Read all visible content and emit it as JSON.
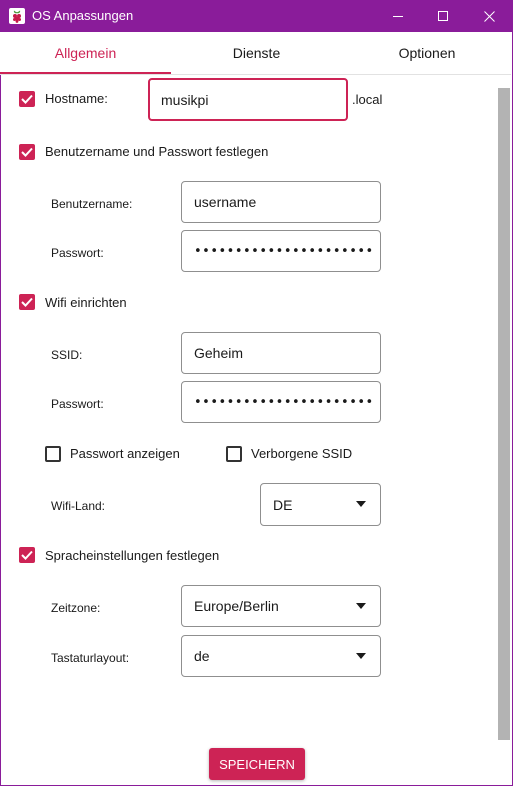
{
  "window": {
    "title": "OS Anpassungen"
  },
  "colors": {
    "titlebar": "#8a1c9a",
    "accent": "#cd2355"
  },
  "tabs": [
    {
      "label": "Allgemein",
      "active": true
    },
    {
      "label": "Dienste",
      "active": false
    },
    {
      "label": "Optionen",
      "active": false
    }
  ],
  "hostname": {
    "checked": true,
    "label": "Hostname:",
    "value": "musikpi",
    "suffix": ".local"
  },
  "user": {
    "checked": true,
    "label": "Benutzername und Passwort festlegen",
    "username_label": "Benutzername:",
    "username_value": "username",
    "password_label": "Passwort:",
    "password_value": "••••••••••••••••••••••"
  },
  "wifi": {
    "checked": true,
    "label": "Wifi einrichten",
    "ssid_label": "SSID:",
    "ssid_value": "Geheim",
    "password_label": "Passwort:",
    "password_value": "••••••••••••••••••••••",
    "show_password_label": "Passwort anzeigen",
    "show_password_checked": false,
    "hidden_ssid_label": "Verborgene SSID",
    "hidden_ssid_checked": false,
    "country_label": "Wifi-Land:",
    "country_value": "DE"
  },
  "locale": {
    "checked": true,
    "label": "Spracheinstellungen festlegen",
    "timezone_label": "Zeitzone:",
    "timezone_value": "Europe/Berlin",
    "keyboard_label": "Tastaturlayout:",
    "keyboard_value": "de"
  },
  "save_label": "SPEICHERN",
  "icons": {
    "app": "raspberry-icon",
    "minimize": "minimize-icon",
    "maximize": "maximize-icon",
    "close": "close-icon",
    "check": "check-icon",
    "dropdown": "chevron-down-icon"
  }
}
